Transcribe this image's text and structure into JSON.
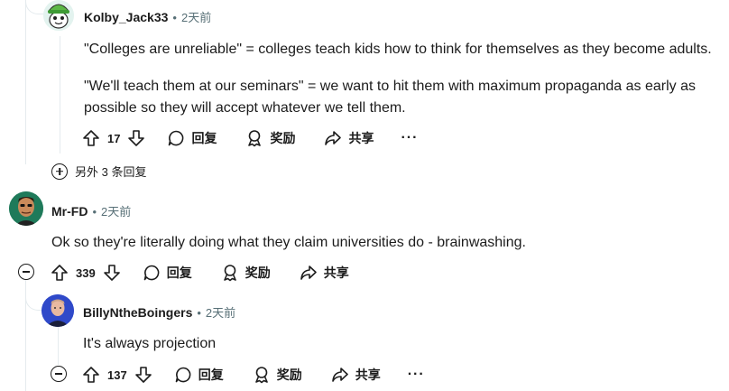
{
  "comments": [
    {
      "author": "Kolby_Jack33",
      "separator": "•",
      "time": "2天前",
      "paragraphs": [
        "\"Colleges are unreliable\" = colleges teach kids how to think for themselves as they become adults.",
        "\"We'll teach them at our seminars\" = we want to hit them with maximum propaganda as early as possible so they will accept whatever we tell them."
      ],
      "votes": "17",
      "reply_label": "回复",
      "award_label": "奖励",
      "share_label": "共享",
      "more_label": "···",
      "avatar_icon": "snoo-green-hat-avatar"
    },
    {
      "author": "Mr-FD",
      "separator": "•",
      "time": "2天前",
      "paragraphs": [
        "Ok so they're literally doing what they claim universities do - brainwashing."
      ],
      "votes": "339",
      "reply_label": "回复",
      "award_label": "奖励",
      "share_label": "共享",
      "avatar_icon": "cartoon-man-avatar"
    },
    {
      "author": "BillyNtheBoingers",
      "separator": "•",
      "time": "2天前",
      "paragraphs": [
        "It's always projection"
      ],
      "votes": "137",
      "reply_label": "回复",
      "award_label": "奖励",
      "share_label": "共享",
      "more_label": "···",
      "avatar_icon": "photo-man-avatar"
    }
  ],
  "more_replies": "另外 3 条回复",
  "colors": {
    "thread_line": "#e5ebee",
    "meta_gray": "#576f76",
    "text": "#1c1c1c"
  }
}
